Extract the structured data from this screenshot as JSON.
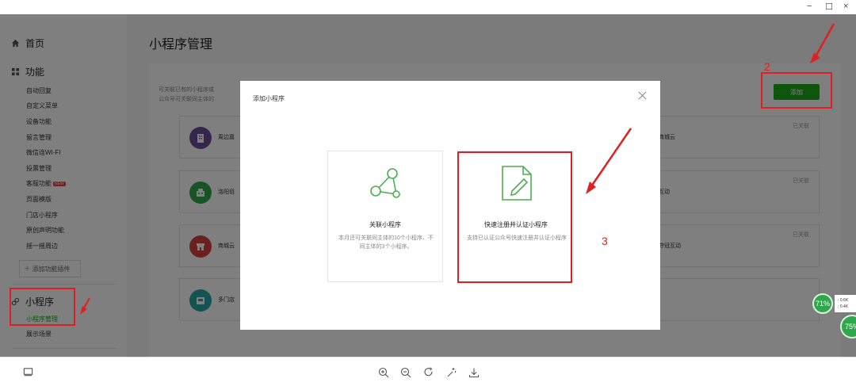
{
  "window": {
    "minimize": "−",
    "maximize": "☐",
    "close": "×"
  },
  "sidebar": {
    "home": "首页",
    "features_title": "功能",
    "features": [
      "自动回复",
      "自定义菜单",
      "设备功能",
      "留言管理",
      "微信连WI-FI",
      "投票管理",
      "客服功能",
      "页面模版",
      "门店小程序",
      "原创声明功能",
      "摇一摇周边"
    ],
    "new_badge": "NEW",
    "add_plugin": "添加功能插件",
    "miniprogram_title": "小程序",
    "miniprogram_items": [
      "小程序管理",
      "展示场景"
    ]
  },
  "main": {
    "page_title": "小程序管理",
    "desc_line1": "可关联已有的小程序或",
    "desc_line2": "公众号可关联同主体的",
    "add_button": "添加",
    "cards": [
      {
        "name": "周边嘉",
        "right": "福商城云",
        "status": "已关联",
        "icon_color": "#6a4c9c",
        "icon": "building-icon"
      },
      {
        "name": "洛阳佰",
        "right": "层互动",
        "status": "已关联",
        "icon_color": "#2ea84a",
        "icon": "cashier-icon"
      },
      {
        "name": "商城云",
        "right": "南夺冠互动",
        "status": "已关联",
        "icon_color": "#d64040",
        "icon": "store-icon"
      },
      {
        "name": "多门店",
        "right": "",
        "status": "",
        "icon_color": "#2aa5a5",
        "icon": "shop-icon"
      }
    ]
  },
  "modal": {
    "title": "添加小程序",
    "option1": {
      "title": "关联小程序",
      "desc": "本月还可关联同主体的10个小程序、不同主体的3个小程序。"
    },
    "option2": {
      "title": "快速注册并认证小程序",
      "desc": "支持已认证公众号快速注册并认证小程序"
    }
  },
  "annotations": {
    "num2": "2",
    "num3": "3",
    "color": "#e02020"
  },
  "badges": {
    "badge1": "71%",
    "badge2": "75%",
    "upload": "0.6K",
    "download": "0.4K"
  }
}
